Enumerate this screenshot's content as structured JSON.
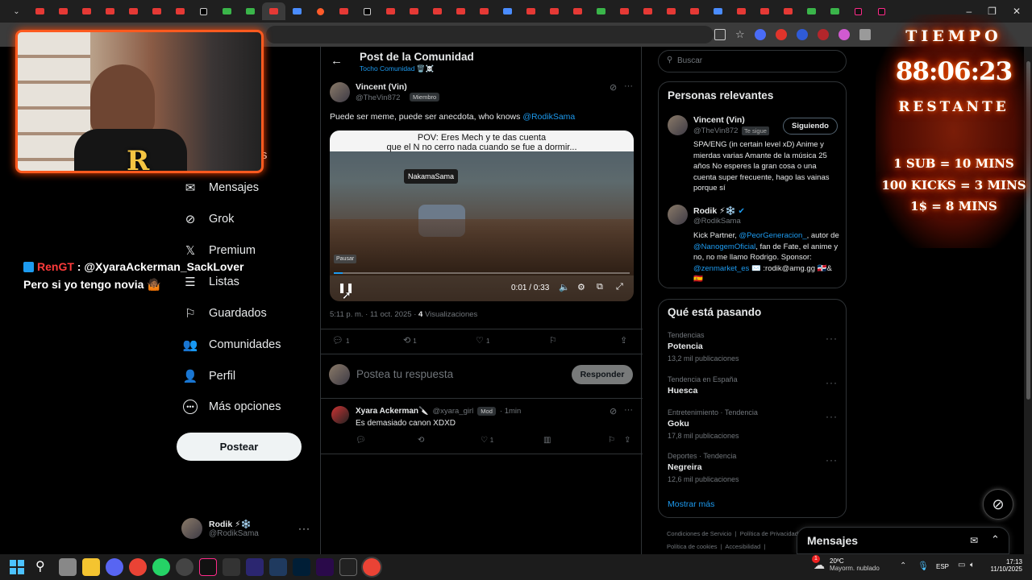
{
  "browser": {
    "tab_count": 54,
    "active_tab_index": 10,
    "window_controls": [
      "–",
      "❐",
      "✕"
    ]
  },
  "leftnav": {
    "partial_item": "nes",
    "items": [
      {
        "label": "Mensajes",
        "icon": "mail-icon"
      },
      {
        "label": "Grok",
        "icon": "grok-icon"
      },
      {
        "label": "Premium",
        "icon": "x-logo-icon"
      },
      {
        "label": "Listas",
        "icon": "list-icon"
      },
      {
        "label": "Guardados",
        "icon": "bookmark-icon"
      },
      {
        "label": "Comunidades",
        "icon": "communities-icon"
      },
      {
        "label": "Perfil",
        "icon": "profile-icon"
      },
      {
        "label": "Más opciones",
        "icon": "more-icon"
      }
    ],
    "post_button": "Postear",
    "account": {
      "name": "Rodik ⚡❄️",
      "handle": "@RodikSama"
    }
  },
  "main": {
    "header_title": "Post de la Comunidad",
    "header_sub": "Tocho Comunidad 🗑️☠️",
    "post": {
      "author": "Vincent (Vin)",
      "handle": "@TheVin872",
      "badge": "Miembro",
      "text_before": "Puede ser meme, puede ser anecdota, who knows ",
      "mention": "@RodikSama",
      "video": {
        "caption_line1": "POV: Eres Mech y te das cuenta",
        "caption_line2": "que el N no cerro nada cuando se fue a dormir...",
        "name_tag": "NakamaSama",
        "tooltip": "Pausar",
        "time": "0:01 / 0:33",
        "progress": 0.03
      },
      "timestamp": "5:11 p. m. · 11 oct. 2025 · ",
      "views_count": "4",
      "views_label": " Visualizaciones",
      "replies": "1",
      "reposts": "1",
      "likes": "1"
    },
    "reply_placeholder": "Postea tu respuesta",
    "reply_button": "Responder",
    "comment": {
      "author": "Xyara Ackerman🔪",
      "handle": "@xyara_girl",
      "badge": "Mod",
      "time": "· 1min",
      "text": "Es demasiado canon XDXD",
      "likes": "1"
    }
  },
  "right": {
    "search_placeholder": "Buscar",
    "relevant_title": "Personas relevantes",
    "people": [
      {
        "name": "Vincent (Vin)",
        "handle": "@TheVin872",
        "follows_you": "Te sigue",
        "button": "Siguiendo",
        "bio": "SPA/ENG (in certain level xD) Anime y mierdas varias Amante de la música 25 años No esperes la gran cosa o una cuenta super frecuente, hago las vainas porque sí"
      },
      {
        "name": "Rodik ⚡❄️",
        "handle": "@RodikSama",
        "bio_parts": {
          "a": "Kick Partner, ",
          "b": "@PeorGeneracion_",
          "c": ", autor de ",
          "d": "@NanogemOficial",
          "e": ", fan de Fate, el anime y no, no me llamo Rodrigo. Sponsor: ",
          "f": "@zenmarket_es",
          "g": " ✉️ :rodik@amg.gg 🇩🇴&🇪🇸"
        }
      }
    ],
    "trends_title": "Qué está pasando",
    "trends": [
      {
        "category": "Tendencias",
        "name": "Potencia",
        "count": "13,2 mil publicaciones"
      },
      {
        "category": "Tendencia en España",
        "name": "Huesca",
        "count": ""
      },
      {
        "category": "Entretenimiento · Tendencia",
        "name": "Goku",
        "count": "17,8 mil publicaciones"
      },
      {
        "category": "Deportes · Tendencia",
        "name": "Negreira",
        "count": "12,6 mil publicaciones"
      }
    ],
    "show_more": "Mostrar más",
    "footer_line1a": "Condiciones de Servicio",
    "footer_line1b": "Política de Privacidad",
    "footer_line2a": "Política de cookies",
    "footer_line2b": "Accesibilidad",
    "messages_panel": "Mensajes"
  },
  "overlay": {
    "timer_title": "TIEMPO",
    "timer_value": "88:06:23",
    "timer_sub": "RESTANTE",
    "rule1": "1 SUB = 10 MINS",
    "rule2": "100 KICKS = 3 MINS",
    "rule3": "1$ = 8 MINS",
    "chat_user": "RenGT",
    "chat_sep": " : ",
    "chat_mention": "@XyaraAckerman_SackLover",
    "chat_text": "Pero si yo tengo novia 🤷🏾"
  },
  "taskbar": {
    "weather_temp": "20ºC",
    "weather_desc": "Mayorm. nublado",
    "lang": "ESP",
    "time": "17:13",
    "date": "11/10/2025",
    "notif_badge": "1"
  }
}
